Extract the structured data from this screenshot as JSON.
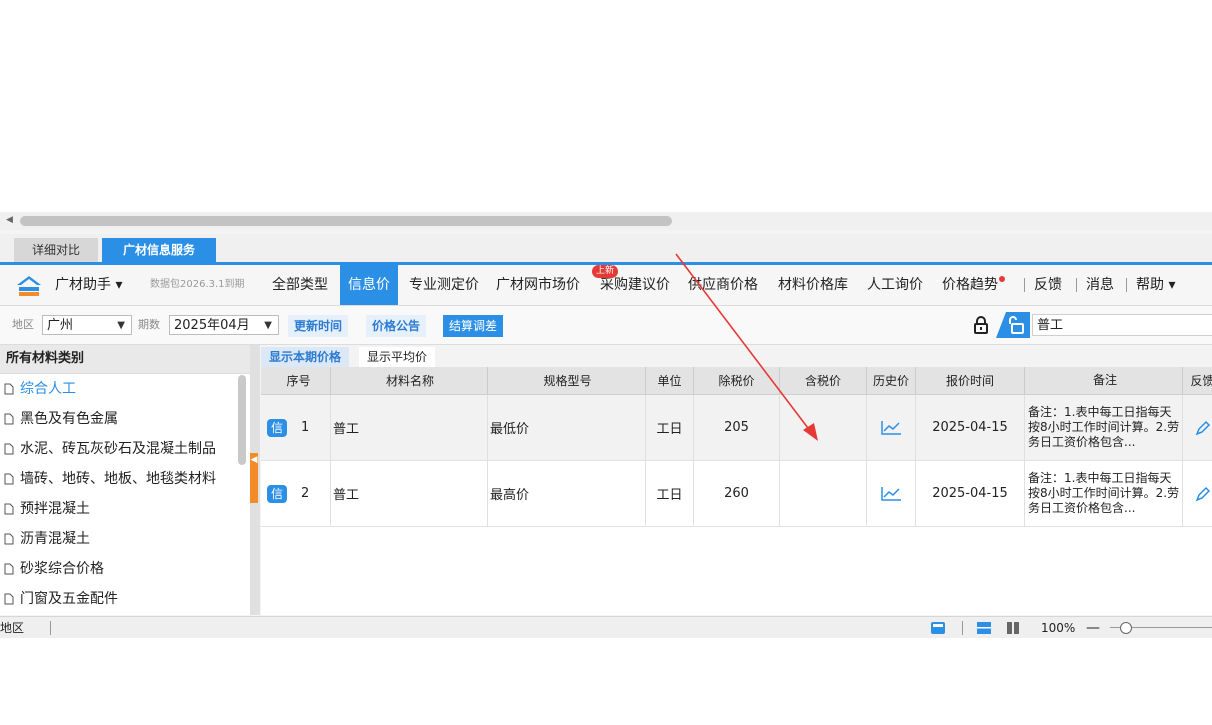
{
  "tabs": {
    "detail": "详细对比",
    "guangcai": "广材信息服务"
  },
  "toolbar": {
    "assistant": "广材助手",
    "datapack": "数据包2026.3.1到期",
    "nav": [
      "全部类型",
      "信息价",
      "专业测定价",
      "广材网市场价",
      "采购建议价",
      "供应商价格",
      "材料价格库",
      "人工询价",
      "价格趋势"
    ],
    "new_badge": "上新",
    "feedback": "反馈",
    "messages": "消息",
    "help": "帮助"
  },
  "filter": {
    "region_label": "地区",
    "region": "广州",
    "period_label": "期数",
    "period": "2025年04月",
    "update_time": "更新时间",
    "price_notice": "价格公告",
    "settle_adjust": "结算调差",
    "search_value": "普工"
  },
  "sidebar": {
    "title": "所有材料类别",
    "items": [
      "综合人工",
      "黑色及有色金属",
      "水泥、砖瓦灰砂石及混凝土制品",
      "墙砖、地砖、地板、地毯类材料",
      "预拌混凝土",
      "沥青混凝土",
      "砂浆综合价格",
      "门窗及五金配件"
    ]
  },
  "subtabs": {
    "current": "显示本期价格",
    "average": "显示平均价"
  },
  "table": {
    "headers": [
      "序号",
      "材料名称",
      "规格型号",
      "单位",
      "除税价",
      "含税价",
      "历史价",
      "报价时间",
      "备注",
      "反馈"
    ],
    "tag": "信",
    "rows": [
      {
        "seq": "1",
        "name": "普工",
        "spec": "最低价",
        "unit": "工日",
        "ex_tax": "205",
        "in_tax": "",
        "time": "2025-04-15",
        "note": "备注：1.表中每工日指每天按8小时工作时间计算。2.劳务日工资价格包含..."
      },
      {
        "seq": "2",
        "name": "普工",
        "spec": "最高价",
        "unit": "工日",
        "ex_tax": "260",
        "in_tax": "",
        "time": "2025-04-15",
        "note": "备注：1.表中每工日指每天按8小时工作时间计算。2.劳务日工资价格包含..."
      }
    ]
  },
  "status": {
    "label": "地区",
    "zoom": "100%"
  },
  "colors": {
    "accent": "#2b8fe6",
    "badge": "#e53935",
    "splitter": "#f28c28"
  }
}
